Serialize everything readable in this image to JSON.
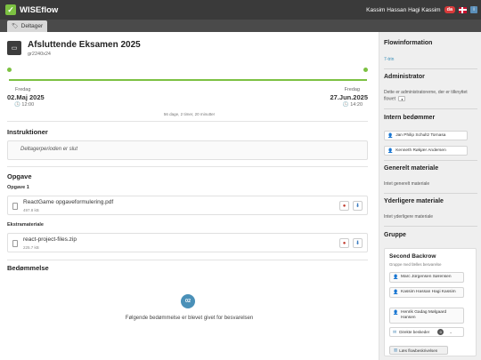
{
  "topbar": {
    "app_name": "WISEflow",
    "user_name": "Kassim Hassan Hagi Kassim",
    "lang": "da",
    "info": "i"
  },
  "tabs": {
    "active_label": "Deltager"
  },
  "exam": {
    "title": "Afsluttende Eksamen 2025",
    "code": "gr2240x24",
    "start": {
      "weekday": "Fredag",
      "date": "02.Maj 2025",
      "time": "12:00"
    },
    "end": {
      "weekday": "Fredag",
      "date": "27.Jun.2025",
      "time": "14:20"
    },
    "duration": "56 dage, 2 timer, 20 minutter"
  },
  "instructions": {
    "heading": "Instruktioner",
    "text": "Deltagerperioden er slut"
  },
  "assignment": {
    "heading": "Opgave",
    "sub_heading": "Opgave 1",
    "file": {
      "name": "ReactGame opgaveformulering.pdf",
      "size": "497.8 kB"
    },
    "extra_heading": "Ekstramateriale",
    "extra_file": {
      "name": "react-project-files.zip",
      "size": "225.7 kB"
    }
  },
  "grading": {
    "heading": "Bedømmelse",
    "badge": "02",
    "text": "Følgende bedømmelse er blevet givet for besvarelsen"
  },
  "sidebar": {
    "flow_info_title": "Flowinformation",
    "flow_info_value": "7-trin",
    "admin_title": "Administrator",
    "admin_text": "Dette er administratorerne, der er tilknyttet flowet",
    "internal_title": "Intern bedømmer",
    "internal_people": [
      "Jan Philip Schultz Tornasa",
      "Kenneth Røkjær Andersen"
    ],
    "general_title": "Generelt materiale",
    "general_text": "Intet generelt materiale",
    "further_title": "Yderligere materiale",
    "further_text": "Intet yderligere materiale",
    "group_title": "Gruppe",
    "group": {
      "name": "Second Backrow",
      "subtitle": "Gruppe med fælles besvarelse",
      "members": [
        "Marc Jürgensen Sørensen",
        "Kassim Hassan Hagi Kassim",
        "Henrik Gadag Mølgaard Hansen"
      ],
      "dm_label": "Direkte beskeder",
      "dm_count": "0",
      "flow_button": "Læs flowbeskrivelsen"
    }
  },
  "colors": {
    "accent_green": "#7cc142",
    "header_bg": "#3a3a3a",
    "badge_blue": "#4a90b8"
  }
}
